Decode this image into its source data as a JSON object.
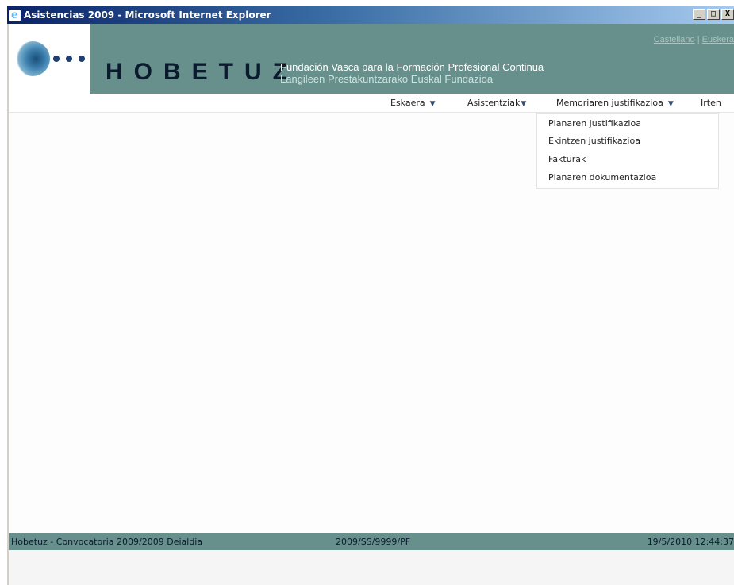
{
  "window": {
    "title": "Asistencias 2009 - Microsoft Internet Explorer",
    "minimize": "_",
    "maximize": "□",
    "close": "X"
  },
  "header": {
    "brand": "HOBETUZ",
    "tagline_es": "Fundación Vasca para la Formación Profesional Continua",
    "tagline_eu": "Langileen Prestakuntzarako Euskal Fundazioa",
    "lang_castellano": "Castellano",
    "lang_separator": " | ",
    "lang_euskera": "Euskera"
  },
  "menu": {
    "eskaera": "Eskaera",
    "asistentziak": "Asistentziak",
    "memoriaren": "Memoriaren justifikazioa",
    "irten": "Irten",
    "arrow_icon": "▼"
  },
  "dropdown": {
    "items": [
      "Planaren justifikazioa",
      "Ekintzen justifikazioa",
      "Fakturak",
      "Planaren dokumentazioa"
    ]
  },
  "status": {
    "left": "Hobetuz - Convocatoria 2009/2009 Deialdia",
    "center": "2009/SS/9999/PF",
    "right": "19/5/2010 12:44:37"
  },
  "colors": {
    "banner": "#67908c",
    "titlebar_start": "#0a246a",
    "brand_text": "#0b1b2e"
  }
}
